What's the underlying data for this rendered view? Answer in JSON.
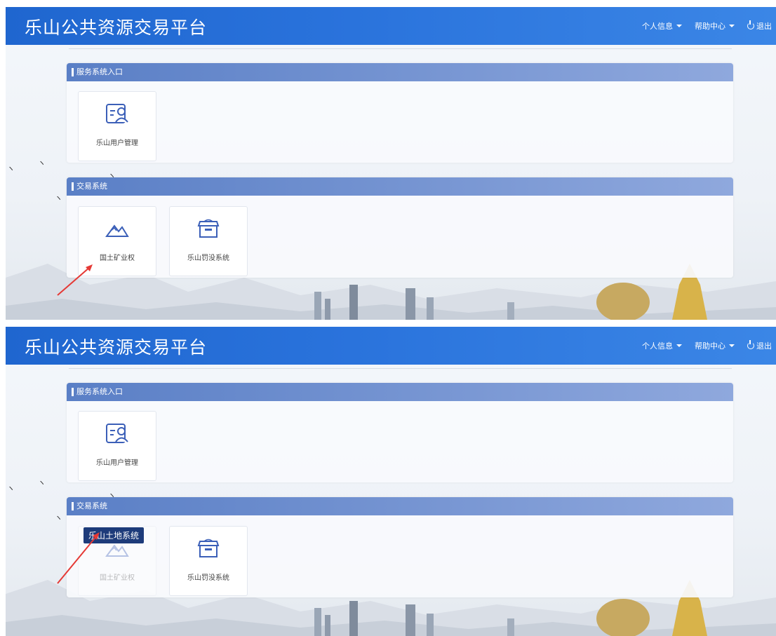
{
  "header": {
    "title": "乐山公共资源交易平台",
    "menu": {
      "profile": "个人信息",
      "help": "帮助中心",
      "logout": "退出"
    }
  },
  "panels": {
    "service": {
      "heading": "服务系统入口",
      "tiles": [
        {
          "label": "乐山用户管理",
          "icon": "user-card-icon"
        }
      ]
    },
    "trade": {
      "heading": "交易系统",
      "tiles": [
        {
          "label": "国土矿业权",
          "icon": "mountain-icon"
        },
        {
          "label": "乐山罚没系统",
          "icon": "box-icon"
        }
      ]
    }
  },
  "tooltip": {
    "text": "乐山土地系统"
  },
  "colors": {
    "header": "#2a73dc",
    "panel_header": "#6f8fd0",
    "icon": "#3b5fb8",
    "arrow": "#e53935",
    "tooltip_bg": "#1d3b7a"
  }
}
